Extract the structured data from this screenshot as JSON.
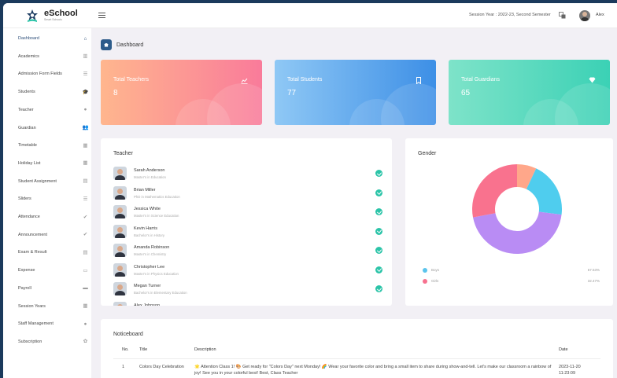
{
  "app": {
    "name": "eSchool",
    "tagline": "Smart Schools"
  },
  "header": {
    "session": "Session Year : 2022-23, Second Semester",
    "user_name": "Alex"
  },
  "sidebar": {
    "items": [
      {
        "label": "Dashboard",
        "icon": "home-icon",
        "glyph": "⌂",
        "active": true
      },
      {
        "label": "Academics",
        "icon": "institution-icon",
        "glyph": "▥"
      },
      {
        "label": "Admission Form Fields",
        "icon": "list-icon",
        "glyph": "☰"
      },
      {
        "label": "Students",
        "icon": "graduation-cap-icon",
        "glyph": "🎓"
      },
      {
        "label": "Teacher",
        "icon": "user-icon",
        "glyph": "●"
      },
      {
        "label": "Guardian",
        "icon": "users-icon",
        "glyph": "👥"
      },
      {
        "label": "Timetable",
        "icon": "calendar-icon",
        "glyph": "▦"
      },
      {
        "label": "Holiday List",
        "icon": "calendar-icon",
        "glyph": "▦"
      },
      {
        "label": "Student Assignment",
        "icon": "book-icon",
        "glyph": "▤"
      },
      {
        "label": "Sliders",
        "icon": "list-icon",
        "glyph": "☰"
      },
      {
        "label": "Attendance",
        "icon": "check-icon",
        "glyph": "✔"
      },
      {
        "label": "Announcement",
        "icon": "check-icon",
        "glyph": "✔"
      },
      {
        "label": "Exam & Result",
        "icon": "book-icon",
        "glyph": "▤"
      },
      {
        "label": "Expense",
        "icon": "money-icon",
        "glyph": "▭"
      },
      {
        "label": "Payroll",
        "icon": "credit-card-icon",
        "glyph": "▬"
      },
      {
        "label": "Session Years",
        "icon": "calendar-icon",
        "glyph": "▦"
      },
      {
        "label": "Staff Management",
        "icon": "user-lock-icon",
        "glyph": "●"
      },
      {
        "label": "Subscription",
        "icon": "settings-icon",
        "glyph": "✿"
      }
    ]
  },
  "page": {
    "title": "Dashboard"
  },
  "stats": {
    "teachers": {
      "label": "Total Teachers",
      "value": "8",
      "icon": "chart-line-icon",
      "glyph": "📈"
    },
    "students": {
      "label": "Total Students",
      "value": "77",
      "icon": "bookmark-icon",
      "glyph": "▯"
    },
    "guardians": {
      "label": "Total Guardians",
      "value": "65",
      "icon": "diamond-icon",
      "glyph": "◆"
    }
  },
  "teacher_card": {
    "title": "Teacher",
    "teachers": [
      {
        "name": "Sarah Anderson",
        "degree": "Master's in Education"
      },
      {
        "name": "Brian Miller",
        "degree": "PhD in Mathematics Education"
      },
      {
        "name": "Jessica White",
        "degree": "Master's in Science Education"
      },
      {
        "name": "Kevin Harris",
        "degree": "Bachelor's in History"
      },
      {
        "name": "Amanda Robinson",
        "degree": "Master's in Chemistry"
      },
      {
        "name": "Christopher Lee",
        "degree": "Master's in Physics Education"
      },
      {
        "name": "Megan Turner",
        "degree": "Bachelor's in Elementary Education"
      },
      {
        "name": "Alex Johnson",
        "degree": ""
      }
    ]
  },
  "gender_card": {
    "title": "Gender",
    "legend": [
      {
        "label": "Boys",
        "value": "67.53%",
        "color": "#5bc4ec"
      },
      {
        "label": "Girls",
        "value": "32.47%",
        "color": "#f7718f"
      }
    ]
  },
  "chart_data": {
    "type": "pie",
    "title": "Gender",
    "donut": true,
    "categories": [
      "Boys",
      "Girls"
    ],
    "values": [
      67.53,
      32.47
    ],
    "segments": [
      {
        "label": "",
        "value": 7,
        "color": "#ffa78a"
      },
      {
        "label": "",
        "value": 20,
        "color": "#4fcdee"
      },
      {
        "label": "",
        "value": 45,
        "color": "#b98cf4"
      },
      {
        "label": "",
        "value": 28,
        "color": "#f9728e"
      }
    ]
  },
  "noticeboard": {
    "title": "Noticeboard",
    "columns": [
      "No.",
      "Title",
      "Description",
      "Date"
    ],
    "rows": [
      {
        "no": "1",
        "title": "Colors Day Celebration",
        "description": "🌟 Attention Class 1! 🎨 Get ready for \"Colors Day\" next Monday! 🌈 Wear your favorite color and bring a small item to share during show-and-tell. Let's make our classroom a rainbow of joy! See you in your colorful best! Best, Class Teacher",
        "date": "2023-11-20 11:23:09"
      }
    ]
  },
  "colors": {
    "brand": "#2d5b8a",
    "check": "#2bc4a8"
  }
}
